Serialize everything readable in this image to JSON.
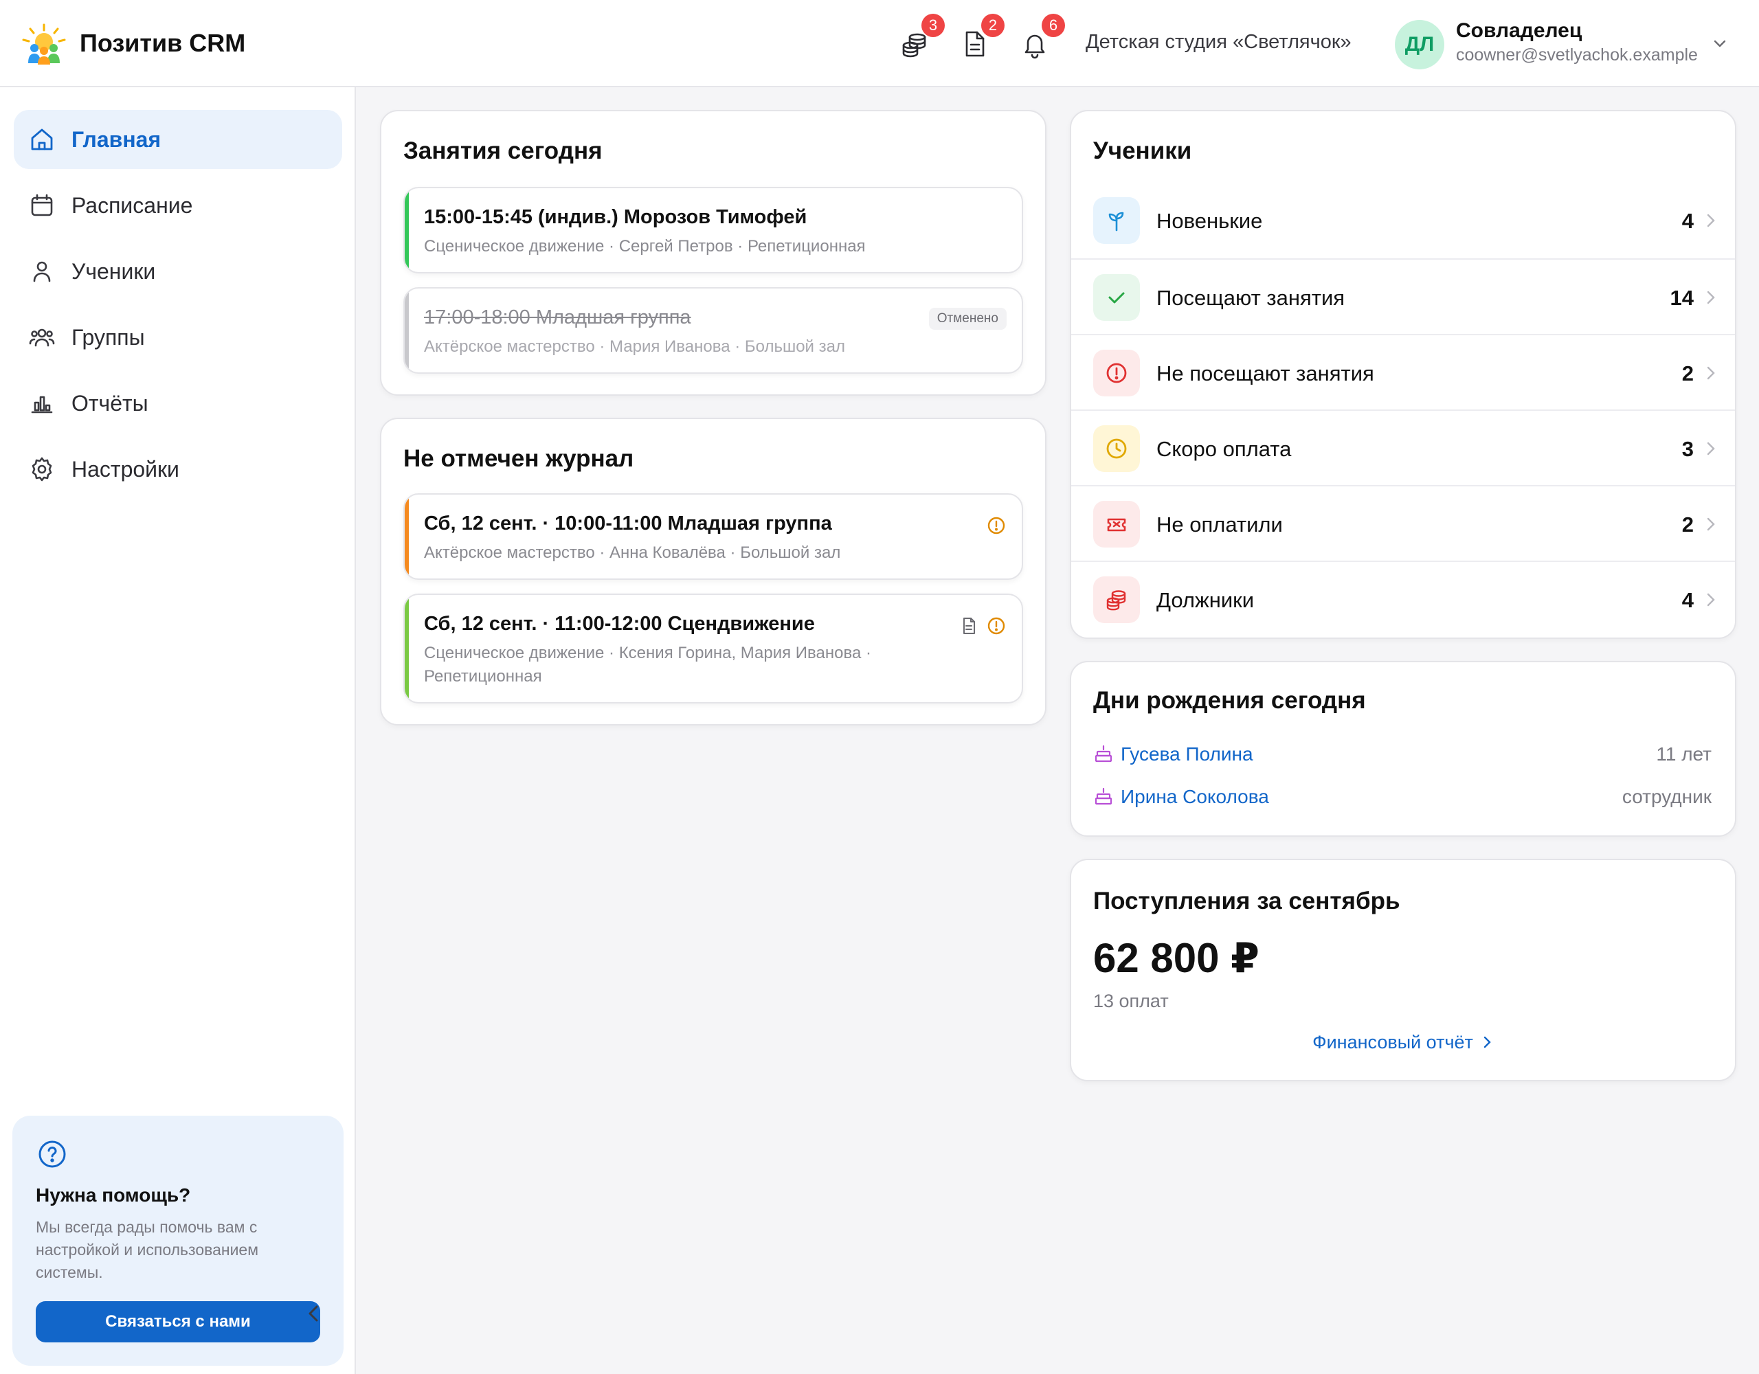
{
  "header": {
    "app_title": "Позитив CRM",
    "studio": "Детская студия «Светлячок»",
    "icons": [
      {
        "name": "finance-icon",
        "badge": "3"
      },
      {
        "name": "document-icon",
        "badge": "2"
      },
      {
        "name": "bell-icon",
        "badge": "6"
      }
    ],
    "user": {
      "initials": "ДЛ",
      "role": "Совладелец",
      "email": "coowner@svetlyachok.example"
    }
  },
  "sidebar": {
    "items": [
      {
        "label": "Главная",
        "icon": "home-icon",
        "active": true
      },
      {
        "label": "Расписание",
        "icon": "calendar-icon"
      },
      {
        "label": "Ученики",
        "icon": "user-icon"
      },
      {
        "label": "Группы",
        "icon": "users-icon"
      },
      {
        "label": "Отчёты",
        "icon": "chart-icon"
      },
      {
        "label": "Настройки",
        "icon": "gear-icon"
      }
    ],
    "help": {
      "title": "Нужна помощь?",
      "text": "Мы всегда рады помочь вам с настройкой и использованием системы.",
      "button": "Связаться с нами"
    }
  },
  "today": {
    "title": "Занятия сегодня",
    "lessons": [
      {
        "title": "15:00-15:45 (индив.) Морозов Тимофей",
        "sub": "Сценическое движение · Сергей Петров · Репетиционная",
        "color": "#34c759",
        "cancelled": false
      },
      {
        "title": "17:00-18:00 Младшая группа",
        "sub": "Актёрское мастерство · Мария Иванова · Большой зал",
        "color": "#c8c8cc",
        "cancelled": true,
        "tag": "Отменено"
      }
    ]
  },
  "journal": {
    "title": "Не отмечен журнал",
    "lessons": [
      {
        "title": "Сб, 12 сент. · 10:00-11:00 Младшая группа",
        "sub": "Актёрское мастерство · Анна Ковалёва · Большой зал",
        "color": "#f58a1f"
      },
      {
        "title": "Сб, 12 сент. · 11:00-12:00 Сцендвижение",
        "sub": "Сценическое движение · Ксения Горина, Мария Иванова · Репетиционная",
        "color": "#7ac943"
      }
    ]
  },
  "students": {
    "title": "Ученики",
    "rows": [
      {
        "label": "Новенькие",
        "count": "4",
        "icon": "sprout-icon",
        "bg": "#e6f3fd",
        "fg": "#1b8fd6"
      },
      {
        "label": "Посещают занятия",
        "count": "14",
        "icon": "check-icon",
        "bg": "#e8f7ec",
        "fg": "#28a745"
      },
      {
        "label": "Не посещают занятия",
        "count": "2",
        "icon": "alert-icon",
        "bg": "#fdeaea",
        "fg": "#e03131"
      },
      {
        "label": "Скоро оплата",
        "count": "3",
        "icon": "clock-icon",
        "bg": "#fff6d6",
        "fg": "#e0a800"
      },
      {
        "label": "Не оплатили",
        "count": "2",
        "icon": "ticket-icon",
        "bg": "#fdeaea",
        "fg": "#e03131"
      },
      {
        "label": "Должники",
        "count": "4",
        "icon": "coins-icon",
        "bg": "#fdeaea",
        "fg": "#e03131"
      }
    ]
  },
  "birthdays": {
    "title": "Дни рождения сегодня",
    "items": [
      {
        "name": "Гусева Полина",
        "meta": "11 лет"
      },
      {
        "name": "Ирина Соколова",
        "meta": "сотрудник"
      }
    ]
  },
  "income": {
    "title": "Поступления за сентябрь",
    "amount": "62 800 ₽",
    "count": "13 оплат",
    "link": "Финансовый отчёт"
  }
}
